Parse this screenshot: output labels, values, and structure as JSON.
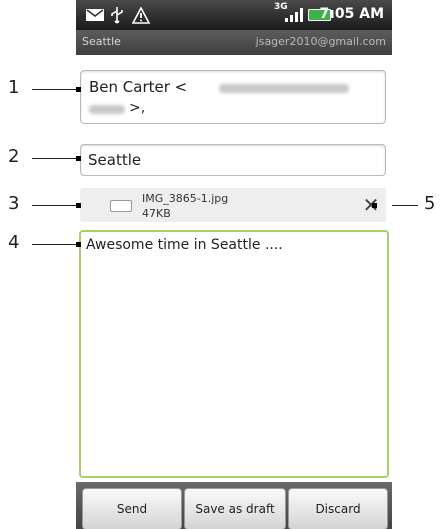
{
  "statusbar": {
    "network_label": "3G",
    "time": "7:05 AM",
    "icons": [
      "mail-icon",
      "usb-icon",
      "warning-icon",
      "signal-icon",
      "battery-icon"
    ]
  },
  "header": {
    "title": "Seattle",
    "account": "jsager2010@gmail.com"
  },
  "compose": {
    "to_name": "Ben  Carter <",
    "to_tail": ">,",
    "subject": "Seattle",
    "body": "Awesome time in Seattle ....",
    "attachment": {
      "name": "IMG_3865-1.jpg",
      "size": "47KB"
    }
  },
  "buttons": {
    "send": "Send",
    "save_draft": "Save as draft",
    "discard": "Discard"
  },
  "callouts": [
    "1",
    "2",
    "3",
    "4",
    "5"
  ],
  "colors": {
    "focus_border": "#a8cf6c",
    "statusbar": "#2a2a2a"
  }
}
